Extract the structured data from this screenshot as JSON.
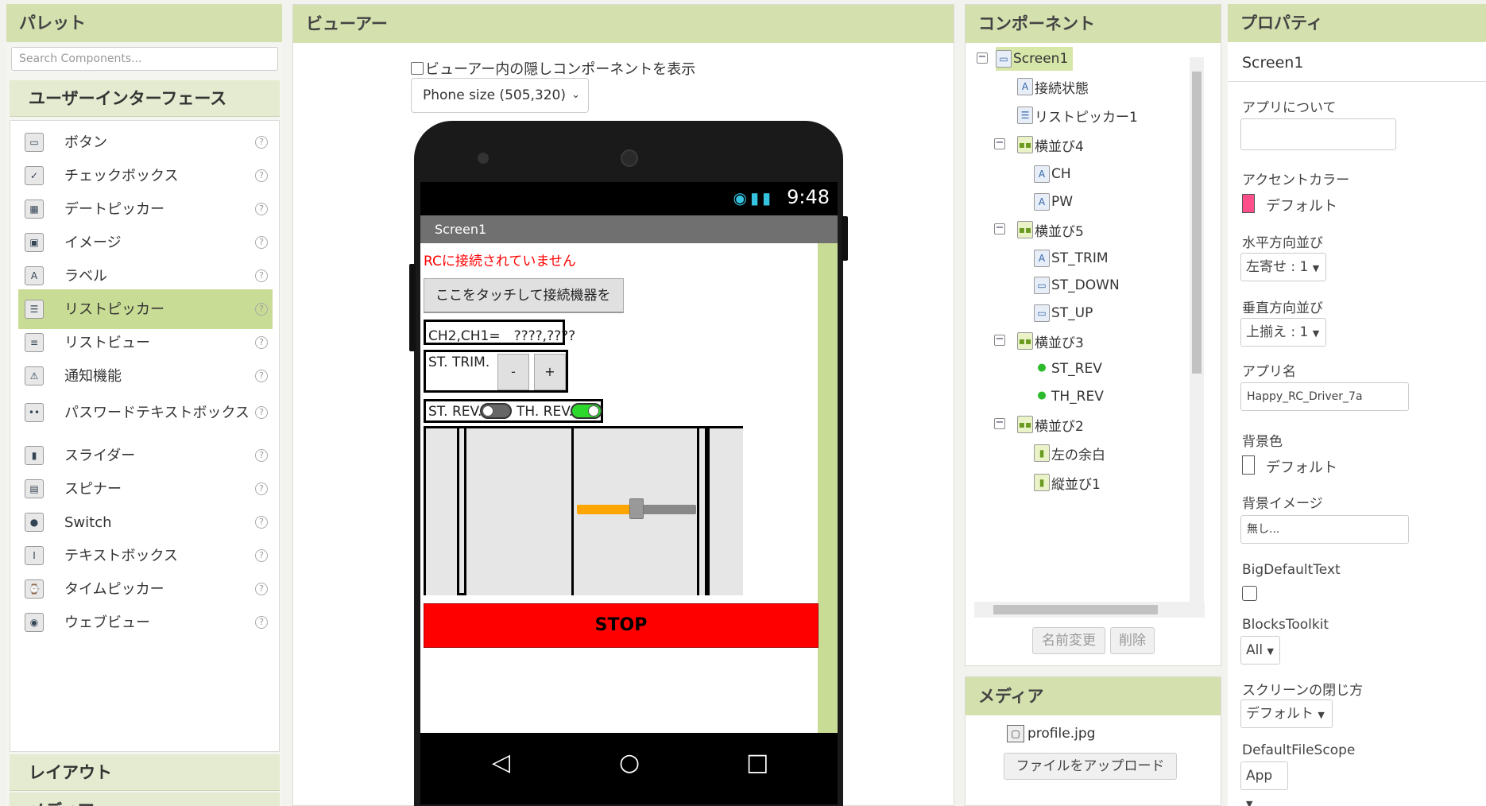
{
  "palette": {
    "title": "パレット",
    "search_placeholder": "Search Components...",
    "section_ui": "ユーザーインターフェース",
    "section_layout": "レイアウト",
    "section_media": "メディア",
    "items": [
      {
        "label": "ボタン",
        "icon": "button-icon"
      },
      {
        "label": "チェックボックス",
        "icon": "checkbox-icon"
      },
      {
        "label": "デートピッカー",
        "icon": "datepicker-icon"
      },
      {
        "label": "イメージ",
        "icon": "image-icon"
      },
      {
        "label": "ラベル",
        "icon": "label-icon"
      },
      {
        "label": "リストピッカー",
        "icon": "listpicker-icon"
      },
      {
        "label": "リストビュー",
        "icon": "listview-icon"
      },
      {
        "label": "通知機能",
        "icon": "notifier-icon"
      },
      {
        "label": "パスワードテキストボックス",
        "icon": "password-icon"
      },
      {
        "label": "スライダー",
        "icon": "slider-icon"
      },
      {
        "label": "スピナー",
        "icon": "spinner-icon"
      },
      {
        "label": "Switch",
        "icon": "switch-icon"
      },
      {
        "label": "テキストボックス",
        "icon": "textbox-icon"
      },
      {
        "label": "タイムピッカー",
        "icon": "timepicker-icon"
      },
      {
        "label": "ウェブビュー",
        "icon": "webview-icon"
      }
    ],
    "help_glyph": "?",
    "selected_index": 5
  },
  "viewer": {
    "title": "ビューアー",
    "hidden_checkbox_label": "ビューアー内の隠しコンポーネントを表示",
    "size_select": "Phone size (505,320)",
    "phone": {
      "time": "9:48",
      "screen_title": "Screen1",
      "status_label": "RCに接続されていません",
      "connect_button": "ここをタッチして接続機器を選ぶ",
      "ch_label": "CH2,CH1=　????,????",
      "trim_label": "ST. TRIM.",
      "minus": "-",
      "plus": "+",
      "st_rev": "ST. REV.",
      "th_rev": "TH. REV.",
      "stop": "STOP",
      "slider_value": 0.5
    }
  },
  "components": {
    "title": "コンポーネント",
    "tree": [
      {
        "label": "Screen1",
        "depth": 0,
        "toggle": "⊟",
        "icon": "screen-icon",
        "selected": true
      },
      {
        "label": "接続状態",
        "depth": 1,
        "icon": "label-icon"
      },
      {
        "label": "リストピッカー1",
        "depth": 1,
        "icon": "listpicker-icon"
      },
      {
        "label": "横並び4",
        "depth": 1,
        "toggle": "⊟",
        "icon": "hbox-icon"
      },
      {
        "label": "CH",
        "depth": 2,
        "icon": "label-icon"
      },
      {
        "label": "PW",
        "depth": 2,
        "icon": "label-icon"
      },
      {
        "label": "横並び5",
        "depth": 1,
        "toggle": "⊟",
        "icon": "hbox-icon"
      },
      {
        "label": "ST_TRIM",
        "depth": 2,
        "icon": "label-icon"
      },
      {
        "label": "ST_DOWN",
        "depth": 2,
        "icon": "button-icon"
      },
      {
        "label": "ST_UP",
        "depth": 2,
        "icon": "button-icon"
      },
      {
        "label": "横並び3",
        "depth": 1,
        "toggle": "⊟",
        "icon": "hbox-icon"
      },
      {
        "label": "ST_REV",
        "depth": 2,
        "icon": "switch-icon"
      },
      {
        "label": "TH_REV",
        "depth": 2,
        "icon": "switch-icon"
      },
      {
        "label": "横並び2",
        "depth": 1,
        "toggle": "⊟",
        "icon": "hbox-icon"
      },
      {
        "label": "左の余白",
        "depth": 2,
        "icon": "vbox-icon"
      },
      {
        "label": "縦並び1",
        "depth": 2,
        "icon": "vbox-icon"
      }
    ],
    "rename_button": "名前変更",
    "delete_button": "削除"
  },
  "media": {
    "title": "メディア",
    "file": "profile.jpg",
    "upload_button": "ファイルをアップロード"
  },
  "properties": {
    "title": "プロパティ",
    "screen_name": "Screen1",
    "about_label": "アプリについて",
    "accent_label": "アクセントカラー",
    "accent_value": "デフォルト",
    "accent_color": "#ff4f8b",
    "halign_label": "水平方向並び",
    "halign_value": "左寄せ : 1",
    "valign_label": "垂直方向並び",
    "valign_value": "上揃え : 1",
    "appname_label": "アプリ名",
    "appname_value": "Happy_RC_Driver_7a",
    "bgcolor_label": "背景色",
    "bgcolor_value": "デフォルト",
    "bgimage_label": "背景イメージ",
    "bgimage_value": "無し...",
    "bigtext_label": "BigDefaultText",
    "blocks_label": "BlocksToolkit",
    "blocks_value": "All",
    "close_label": "スクリーンの閉じ方",
    "close_value": "デフォルト",
    "filescope_label": "DefaultFileScope",
    "filescope_value": "App"
  },
  "colors": {
    "header_bg": "#d4e0ae",
    "selected_bg": "#c9dc95",
    "stop_red": "#ff0000",
    "slider_orange": "#ffa500",
    "switch_green": "#2dd82d"
  }
}
